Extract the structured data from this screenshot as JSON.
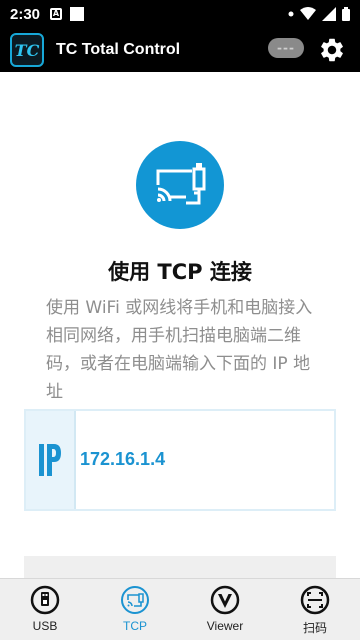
{
  "status_bar": {
    "time": "2:30",
    "icons": [
      "a-notification-icon",
      "square-notification-icon",
      "dot-icon",
      "wifi-icon",
      "signal-icon",
      "battery-icon"
    ]
  },
  "app_bar": {
    "title": "TC Total Control",
    "logo_text": "TC",
    "pill_text": "---",
    "icons": [
      "gear-icon"
    ]
  },
  "tcp_panel": {
    "icon": "cast-network-icon",
    "heading": "使用 TCP 连接",
    "description": "使用 WiFi 或网线将手机和电脑接入相同网络，用手机扫描电脑端二维码，或者在电脑端输入下面的 IP 地址",
    "ip_label": "IP",
    "ip_address": "172.16.1.4"
  },
  "bottom_nav": {
    "items": [
      {
        "label": "USB",
        "icon": "usb-icon",
        "active": false
      },
      {
        "label": "TCP",
        "icon": "tcp-icon",
        "active": true
      },
      {
        "label": "Viewer",
        "icon": "viewer-icon",
        "active": false
      },
      {
        "label": "扫码",
        "icon": "scan-icon",
        "active": false
      }
    ]
  },
  "colors": {
    "accent": "#1b93d1",
    "circle": "#1296d4",
    "text_muted": "#8e8e8e",
    "app_bar": "#000000"
  }
}
